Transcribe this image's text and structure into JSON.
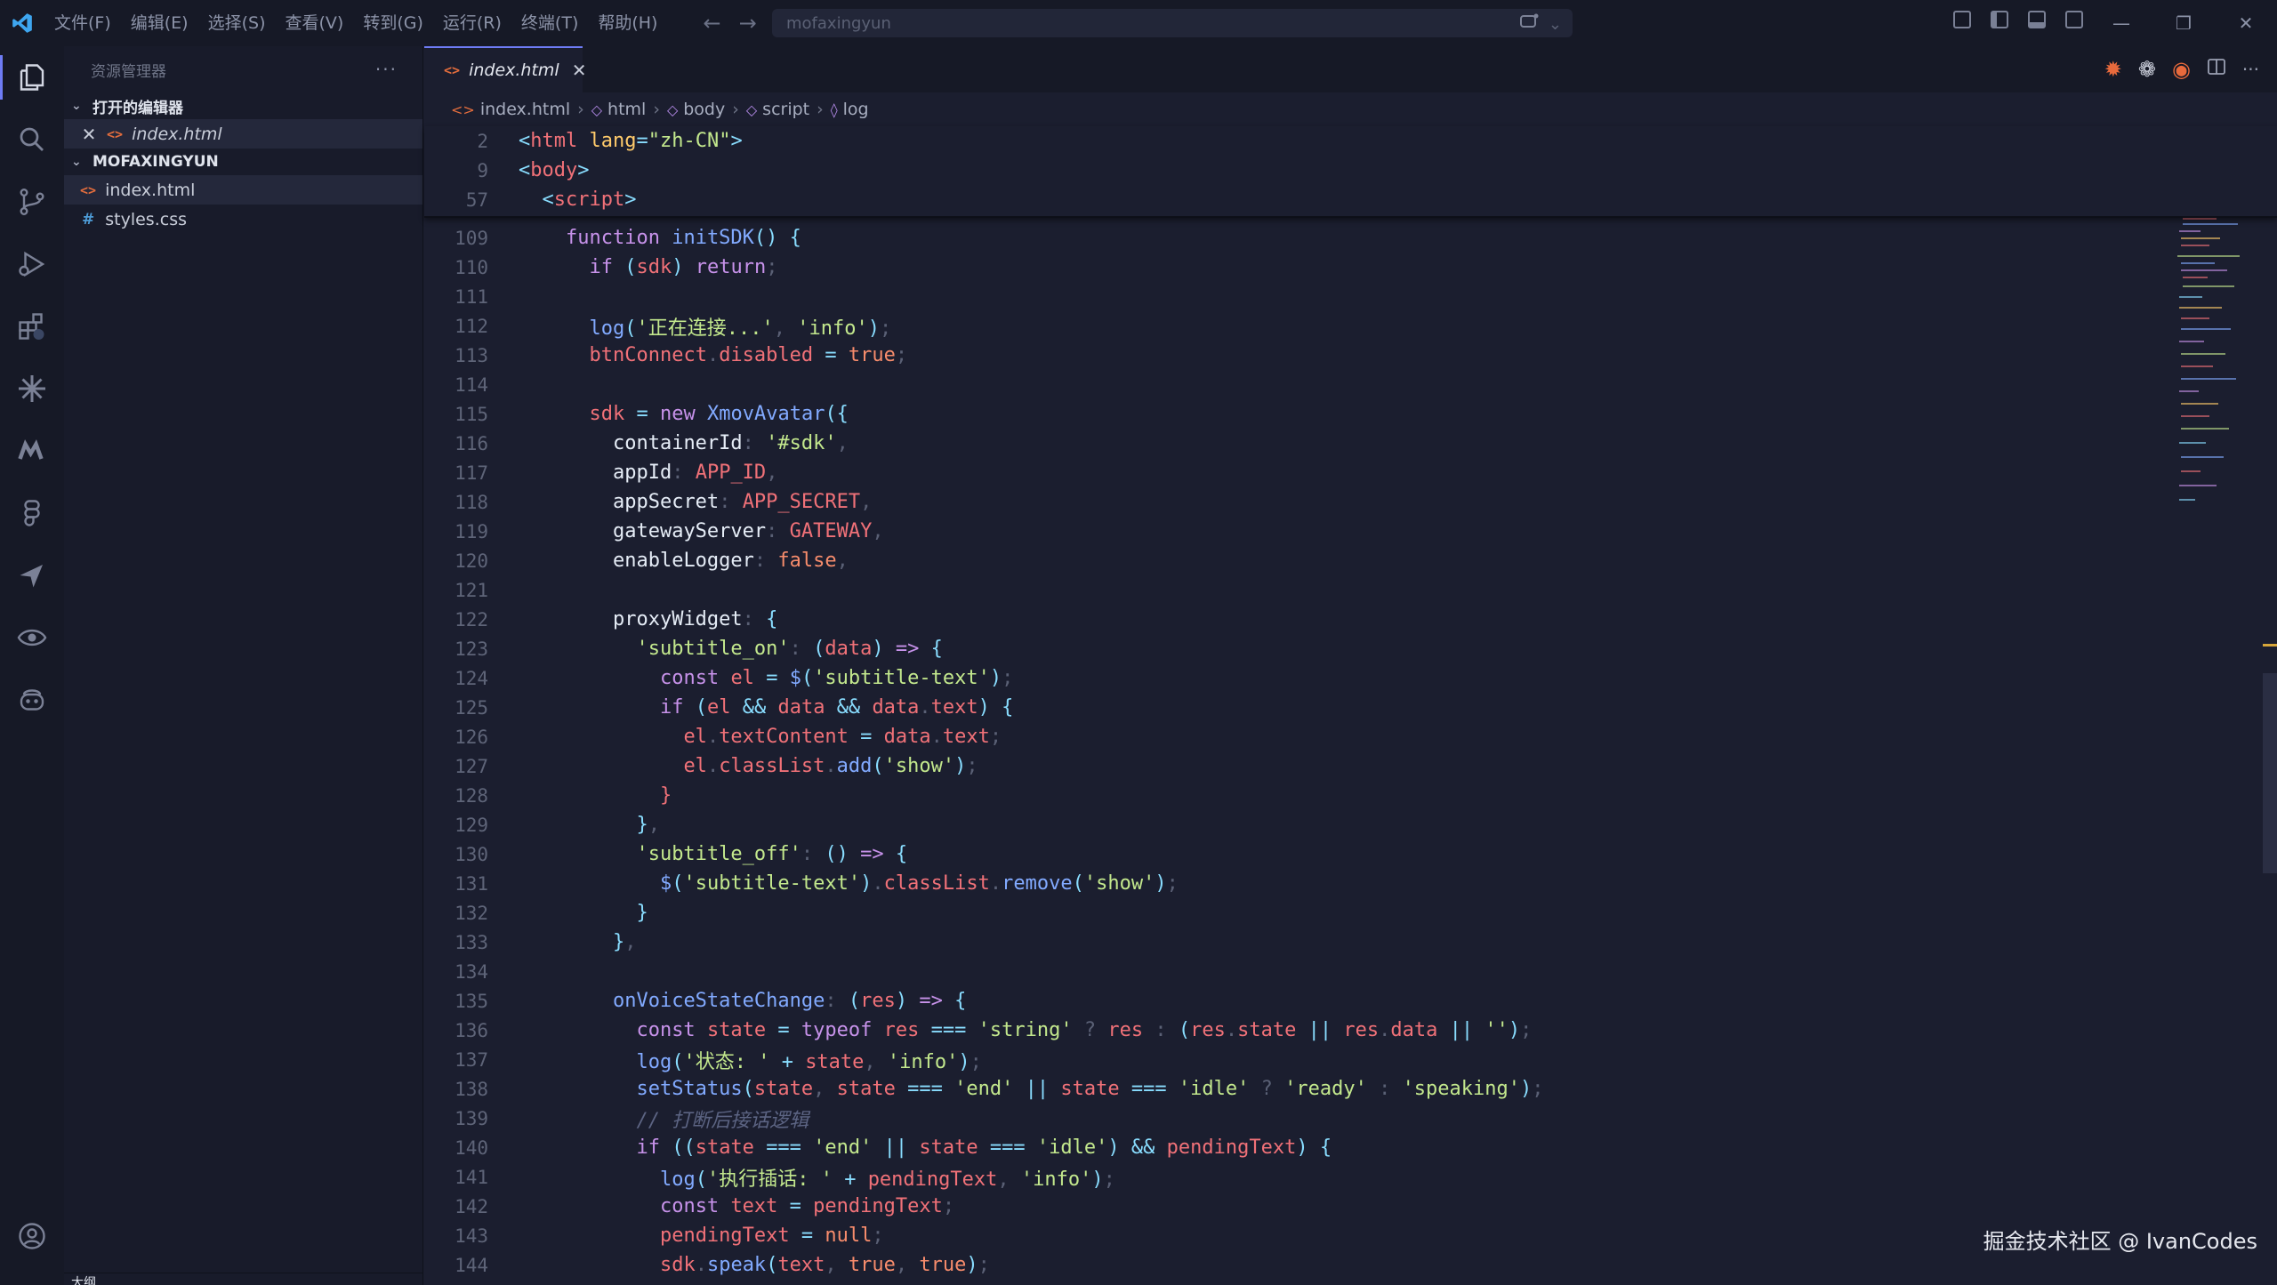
{
  "titlebar": {
    "menus": [
      "文件(F)",
      "编辑(E)",
      "选择(S)",
      "查看(V)",
      "转到(G)",
      "运行(R)",
      "终端(T)",
      "帮助(H)"
    ],
    "search_text": "mofaxingyun"
  },
  "sidebar": {
    "title": "资源管理器",
    "open_editors_label": "打开的编辑器",
    "open_editor_file": "index.html",
    "workspace_label": "MOFAXINGYUN",
    "files": [
      {
        "name": "index.html",
        "type": "html"
      },
      {
        "name": "styles.css",
        "type": "css"
      }
    ],
    "outline_label": "大纲"
  },
  "editor": {
    "tab_label": "index.html",
    "breadcrumb": [
      "index.html",
      "html",
      "body",
      "script",
      "log"
    ]
  },
  "watermark": "掘金技术社区 @ IvanCodes",
  "code": {
    "sticky_lines": [
      {
        "n": "2",
        "text": "<html lang=\"zh-CN\">"
      },
      {
        "n": "9",
        "text": "<body>"
      },
      {
        "n": "57",
        "text": "<script>"
      }
    ],
    "line_numbers": [
      "109",
      "110",
      "111",
      "112",
      "113",
      "114",
      "115",
      "116",
      "117",
      "118",
      "119",
      "120",
      "121",
      "122",
      "123",
      "124",
      "125",
      "126",
      "127",
      "128",
      "129",
      "130",
      "131",
      "132",
      "133",
      "134",
      "135",
      "136",
      "137",
      "138",
      "139",
      "140",
      "141",
      "142",
      "143",
      "144"
    ],
    "strings": {
      "connecting": "'正在连接...'",
      "info": "'info'",
      "sdk_sel": "'#sdk'",
      "subtitle_on": "'subtitle_on'",
      "subtitle_text": "'subtitle-text'",
      "show": "'show'",
      "subtitle_off": "'subtitle_off'",
      "string": "'string'",
      "empty": "''",
      "state_prefix": "'状态: '",
      "end": "'end'",
      "idle": "'idle'",
      "ready": "'ready'",
      "speaking": "'speaking'",
      "comment": "// 打断后接话逻辑",
      "insert_prefix": "'执行插话: '"
    }
  }
}
